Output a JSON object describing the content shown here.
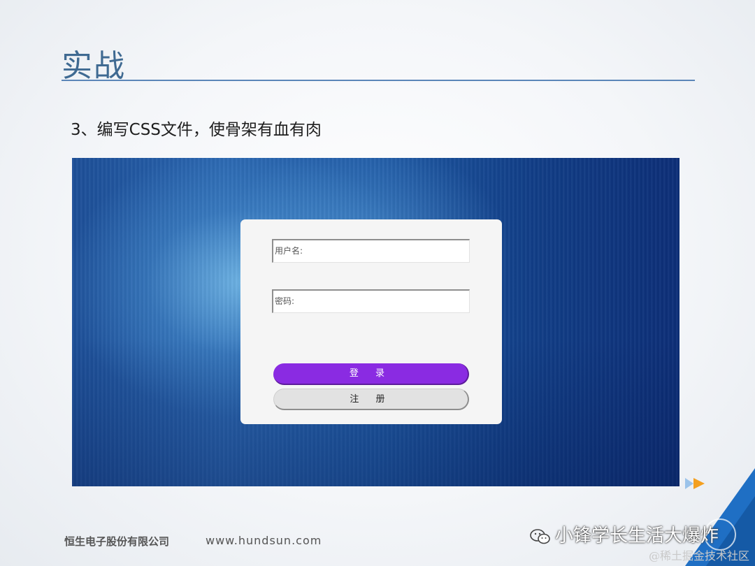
{
  "slide": {
    "title": "实战",
    "subtitle": "3、编写CSS文件，使骨架有血有肉"
  },
  "login_form": {
    "username_placeholder": "用户名:",
    "password_placeholder": "密码:",
    "login_label": "登 录",
    "register_label": "注 册"
  },
  "footer": {
    "company": "恒生电子股份有限公司",
    "url": "www.hundsun.com"
  },
  "watermark": {
    "main": "小锋学长生活大爆炸",
    "sub": "@稀土掘金技术社区"
  },
  "colors": {
    "title": "#3f6a92",
    "login_button": "#8a2be2",
    "background_blue": "#1d4f98"
  }
}
